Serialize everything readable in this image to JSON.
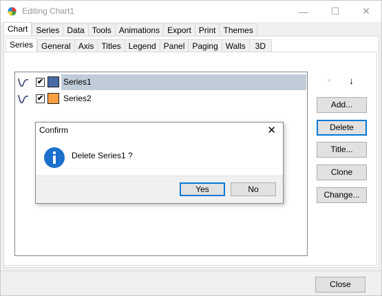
{
  "window": {
    "title": "Editing Chart1",
    "controls": {
      "minimize": "—",
      "maximize": "☐",
      "close": "✕"
    }
  },
  "main_tabs": [
    "Chart",
    "Series",
    "Data",
    "Tools",
    "Animations",
    "Export",
    "Print",
    "Themes"
  ],
  "sub_tabs": [
    "Series",
    "General",
    "Axis",
    "Titles",
    "Legend",
    "Panel",
    "Paging",
    "Walls",
    "3D"
  ],
  "series_list": [
    {
      "name": "Series1",
      "checked": true,
      "color": "#4a6aa5",
      "selected": true
    },
    {
      "name": "Series2",
      "checked": true,
      "color": "#f7a041",
      "selected": false
    }
  ],
  "side_buttons": {
    "add": "Add...",
    "delete": "Delete",
    "title": "Title...",
    "clone": "Clone",
    "change": "Change..."
  },
  "footer": {
    "close": "Close"
  },
  "dialog": {
    "title": "Confirm",
    "close_glyph": "✕",
    "message": "Delete Series1 ?",
    "yes": "Yes",
    "no": "No"
  },
  "colors": {
    "selection": "#c1ccd9",
    "accent_blue": "#0078d7",
    "info_icon": "#1c6fcc"
  }
}
